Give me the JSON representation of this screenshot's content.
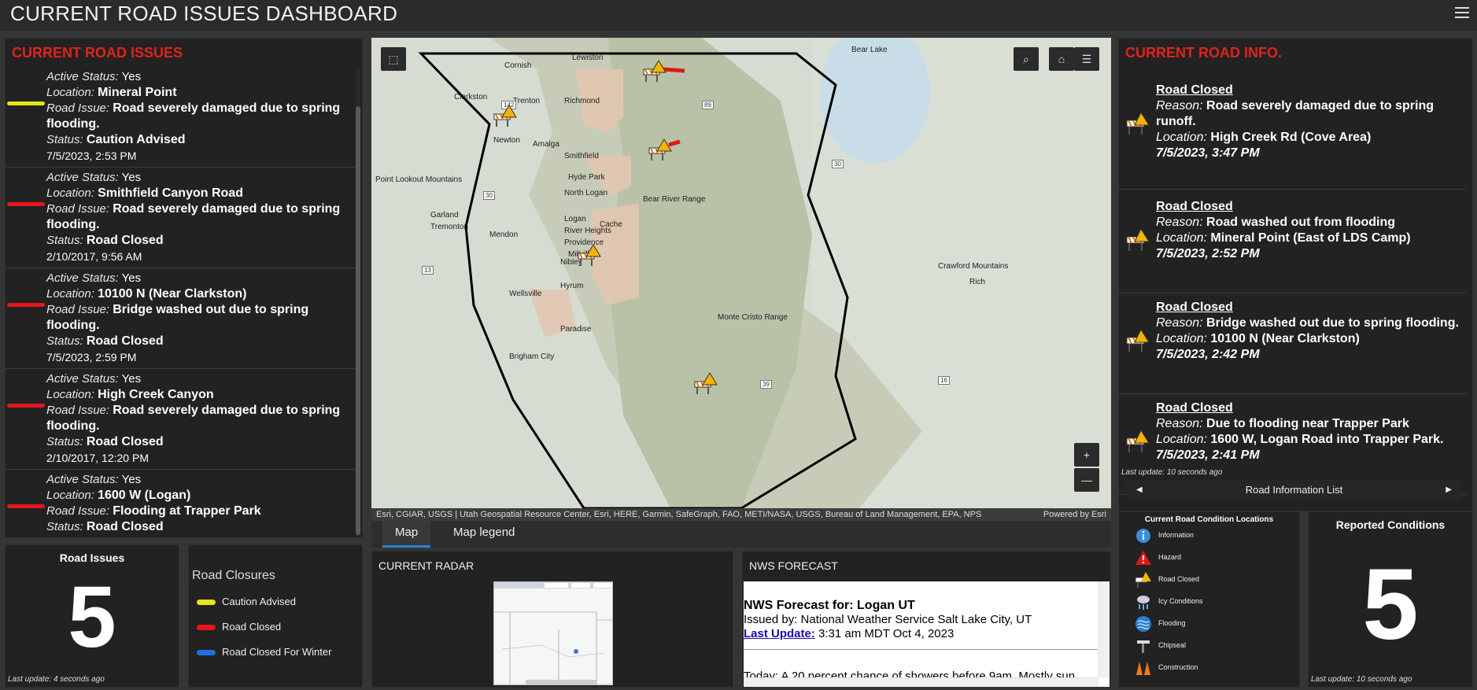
{
  "header": {
    "title": "CURRENT ROAD ISSUES DASHBOARD"
  },
  "issues_panel": {
    "title": "CURRENT ROAD ISSUES",
    "field_labels": {
      "active": "Active Status:",
      "location": "Location:",
      "issue": "Road Issue:",
      "status": "Status:"
    },
    "items": [
      {
        "active": "Yes",
        "location": "Mineral Point",
        "issue": "Road severely damaged due to spring flooding.",
        "status": "Caution Advised",
        "date": "7/5/2023, 2:53 PM",
        "color": "#e6e61a"
      },
      {
        "active": "Yes",
        "location": "Smithfield Canyon Road",
        "issue": "Road severely damaged due to spring flooding.",
        "status": "Road Closed",
        "date": "2/10/2017, 9:56 AM",
        "color": "#e8151b"
      },
      {
        "active": "Yes",
        "location": "10100 N (Near Clarkston)",
        "issue": "Bridge washed out due to spring flooding.",
        "status": "Road Closed",
        "date": "7/5/2023, 2:59 PM",
        "color": "#e8151b"
      },
      {
        "active": "Yes",
        "location": "High Creek Canyon",
        "issue": "Road severely damaged due to spring flooding.",
        "status": "Road Closed",
        "date": "2/10/2017, 12:20 PM",
        "color": "#e8151b"
      },
      {
        "active": "Yes",
        "location": "1600 W (Logan)",
        "issue": "Flooding at Trapper Park",
        "status": "Road Closed",
        "date": "",
        "color": "#e8151b"
      }
    ]
  },
  "map": {
    "labels": [
      "Cornish",
      "Lewiston",
      "Clarkston",
      "Trenton",
      "Richmond",
      "Newton",
      "Amalga",
      "Smithfield",
      "Hyde Park",
      "North Logan",
      "Logan",
      "River Heights",
      "Providence",
      "Millville",
      "Nibley",
      "Mendon",
      "Wellsville",
      "Hyrum",
      "Paradise",
      "Garland",
      "Tremonton",
      "Point Lookout Mountains",
      "Brigham City",
      "Bear River Range",
      "Monte Cristo Range",
      "Crawford Mountains",
      "Rich",
      "Bear Lake",
      "Cache",
      "142",
      "89",
      "30",
      "30",
      "13",
      "16",
      "39"
    ],
    "attribution": "Esri, CGIAR, USGS | Utah Geospatial Resource Center, Esri, HERE, Garmin, SafeGraph, FAO, METI/NASA, USGS, Bureau of Land Management, EPA, NPS",
    "powered_by": "Powered by Esri",
    "zoom_in": "+",
    "zoom_out": "—"
  },
  "tabs": [
    {
      "label": "Map"
    },
    {
      "label": "Map legend"
    }
  ],
  "info_panel": {
    "title": "CURRENT ROAD INFO.",
    "reason_label": "Reason:",
    "location_label": "Location:",
    "items": [
      {
        "heading": "Road Closed",
        "reason": "Road severely damaged due to spring runoff.",
        "location": "High Creek Rd (Cove Area)",
        "date": "7/5/2023, 3:47 PM"
      },
      {
        "heading": "Road Closed",
        "reason": "Road washed out from flooding",
        "location": "Mineral Point (East of LDS Camp)",
        "date": "7/5/2023, 2:52 PM"
      },
      {
        "heading": "Road Closed",
        "reason": "Bridge washed out due to spring flooding.",
        "location": "10100 N (Near Clarkston)",
        "date": "7/5/2023, 2:42 PM"
      },
      {
        "heading": "Road Closed",
        "reason": "Due to flooding near Trapper Park",
        "location": "1600 W, Logan Road into Trapper Park.",
        "date": "7/5/2023, 2:41 PM"
      }
    ],
    "last_update": "Last update: 10 seconds ago",
    "pager_label": "Road Information List"
  },
  "road_issues_count": {
    "title": "Road Issues",
    "value": "5",
    "last_update": "Last update: 4 seconds ago"
  },
  "road_closures": {
    "title": "Road Closures",
    "items": [
      {
        "label": "Caution Advised",
        "color": "#e6e61a"
      },
      {
        "label": "Road Closed",
        "color": "#e8151b"
      },
      {
        "label": "Road Closed For Winter",
        "color": "#1f6fe0"
      }
    ]
  },
  "radar": {
    "title": "CURRENT RADAR"
  },
  "nws": {
    "title": "NWS FORECAST",
    "forecast_for": "NWS Forecast for: Logan UT",
    "issued_by": "Issued by: National Weather Service Salt Lake City, UT",
    "last_update_link": "Last Update:",
    "last_update_value": " 3:31 am MDT Oct 4, 2023",
    "today": "Today: A 20 percent chance of showers before 9am. Mostly sun"
  },
  "legend": {
    "title": "Current Road Condition Locations",
    "items": [
      {
        "label": "Information",
        "icon": "info-icon"
      },
      {
        "label": "Hazard",
        "icon": "hazard-icon"
      },
      {
        "label": "Road Closed",
        "icon": "road-closed-icon"
      },
      {
        "label": "Icy Conditions",
        "icon": "icy-icon"
      },
      {
        "label": "Flooding",
        "icon": "flooding-icon"
      },
      {
        "label": "Chipseal",
        "icon": "chipseal-icon"
      },
      {
        "label": "Construction",
        "icon": "construction-icon"
      }
    ]
  },
  "reported": {
    "title": "Reported Conditions",
    "value": "5",
    "last_update": "Last update: 10 seconds ago"
  }
}
